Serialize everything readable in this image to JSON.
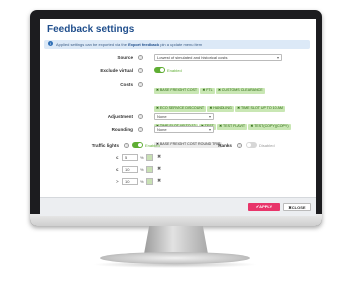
{
  "dialog": {
    "title": "Feedback settings",
    "notice": {
      "text_before": "Applied settings can be exported via the",
      "link": "Export feedback",
      "text_after": "pin a update menu item"
    }
  },
  "fields": {
    "source": {
      "label": "Source",
      "value": "Lowest of simulated and historical costs"
    },
    "exclude_virtual": {
      "label": "Exclude virtual",
      "state": "Enabled",
      "on": true
    },
    "costs": {
      "label": "Costs",
      "chips": [
        {
          "text": "BASE FREIGHT COST",
          "active": true
        },
        {
          "text": "FTL",
          "active": true
        },
        {
          "text": "CUSTOMS CLEARANCE",
          "active": true
        },
        {
          "text": "ECO SERVICE DISCOUNT",
          "active": true
        },
        {
          "text": "HANDLING",
          "active": true
        },
        {
          "text": "TIME SLOT UP TO 10 AM",
          "active": true
        },
        {
          "text": "TIME SLOT UP TO 12",
          "active": true
        },
        {
          "text": "TEST",
          "active": true
        },
        {
          "text": "TEST FLAVIT",
          "active": true
        },
        {
          "text": "TEST(COPY)(COPY)",
          "active": true
        },
        {
          "text": "BASE FREIGHT COST ROUND TRIP",
          "active": false
        }
      ]
    },
    "adjustment": {
      "label": "Adjustment",
      "value": "None"
    },
    "rounding": {
      "label": "Rounding",
      "value": "None"
    },
    "traffic_lights": {
      "label": "Traffic lights",
      "state": "Enabled",
      "on": true,
      "rules": [
        {
          "op": "≤",
          "value": "5",
          "unit": "%"
        },
        {
          "op": "≤",
          "value": "10",
          "unit": "%"
        },
        {
          "op": ">",
          "value": "10",
          "unit": "%"
        }
      ]
    },
    "ranks": {
      "label": "Ranks",
      "state": "Disabled",
      "on": false
    }
  },
  "footer": {
    "apply_label": "✔APPLY",
    "close_label": "✖CLOSE"
  },
  "colors": {
    "accent": "#e8356a",
    "enabled": "#5fae33",
    "chip_bg": "#c9e7b4",
    "title": "#1f4e8c"
  },
  "icons": {
    "help": "help-circle-icon",
    "delete": "close-icon",
    "chevron": "chevron-down-icon"
  }
}
